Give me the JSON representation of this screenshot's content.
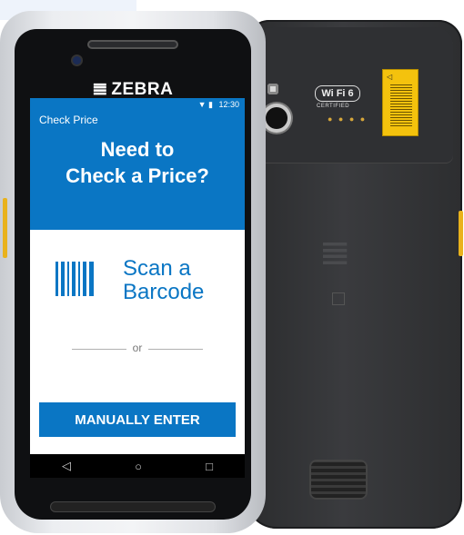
{
  "device": {
    "brand": "ZEBRA",
    "back_badge": "Wi Fi 6",
    "back_badge_sub": "CERTIFIED"
  },
  "status_bar": {
    "time": "12:30",
    "icons": "▼ ▮"
  },
  "app_bar": {
    "title": "Check Price"
  },
  "hero": {
    "line1": "Need to",
    "line2": "Check a Price?"
  },
  "scan": {
    "line1": "Scan a",
    "line2": "Barcode"
  },
  "divider": {
    "text": "or"
  },
  "manual_button": {
    "label": "MANUALLY ENTER"
  },
  "nav": {
    "back": "◁",
    "home": "○",
    "recents": "□"
  },
  "colors": {
    "primary": "#0a76c4",
    "device_back": "#2f3033",
    "accent_button": "#e9b21c"
  }
}
